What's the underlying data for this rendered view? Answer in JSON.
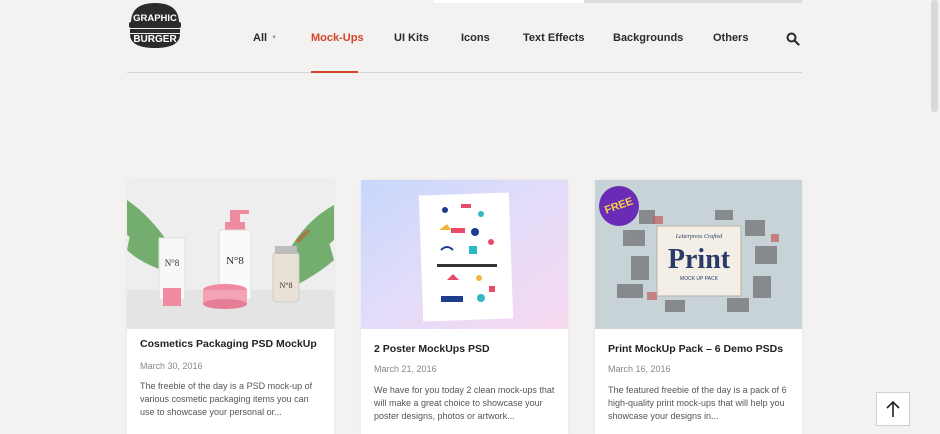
{
  "brand": {
    "logo_line1": "GRAPHIC",
    "logo_line2": "BURGER"
  },
  "nav": {
    "items": [
      {
        "label": "All",
        "has_dropdown": true,
        "active": false
      },
      {
        "label": "Mock-Ups",
        "active": true
      },
      {
        "label": "UI Kits",
        "active": false
      },
      {
        "label": "Icons",
        "active": false
      },
      {
        "label": "Text Effects",
        "active": false
      },
      {
        "label": "Backgrounds",
        "active": false
      },
      {
        "label": "Others",
        "active": false
      }
    ],
    "search_icon": "search-icon",
    "accent_color": "#d2452b"
  },
  "cards": [
    {
      "title": "Cosmetics Packaging PSD MockUp",
      "date": "March 30, 2016",
      "excerpt": "The freebie of the day is a PSD mock-up of various cosmetic packaging items you can use to showcase your personal or...",
      "product_label": "N°8"
    },
    {
      "title": "2 Poster MockUps PSD",
      "date": "March 21, 2016",
      "excerpt": "We have for you today 2 clean mock-ups that will make a great choice to showcase your poster designs, photos or artwork..."
    },
    {
      "title": "Print MockUp Pack – 6 Demo PSDs",
      "date": "March 16, 2016",
      "excerpt": "The featured freebie of the day is a pack of 6 high-quality print mock-ups that will help you showcase your designs in...",
      "badge": "FREE",
      "print_word": "Print",
      "print_sub": "MOCK UP PACK"
    }
  ],
  "back_to_top_icon": "arrow-up-icon"
}
